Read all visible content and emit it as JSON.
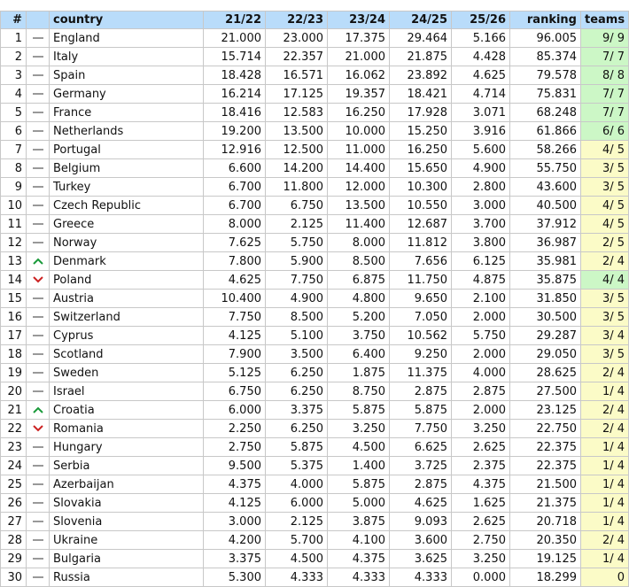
{
  "colors": {
    "header_bg": "#b9dcfa",
    "teams_full": "#ccf7c6",
    "teams_partial": "#fbfbc7",
    "trend_up": "#1a9a3a",
    "trend_down": "#cc2222",
    "trend_same": "#999999"
  },
  "headers": {
    "num": "#",
    "trend": "",
    "country": "country",
    "s1": "21/22",
    "s2": "22/23",
    "s3": "23/24",
    "s4": "24/25",
    "s5": "25/26",
    "ranking": "ranking",
    "teams": "teams"
  },
  "rows": [
    {
      "num": "1",
      "trend": "same",
      "country": "England",
      "s1": "21.000",
      "s2": "23.000",
      "s3": "17.375",
      "s4": "29.464",
      "s5": "5.166",
      "ranking": "96.005",
      "teams": "9/ 9",
      "full": true
    },
    {
      "num": "2",
      "trend": "same",
      "country": "Italy",
      "s1": "15.714",
      "s2": "22.357",
      "s3": "21.000",
      "s4": "21.875",
      "s5": "4.428",
      "ranking": "85.374",
      "teams": "7/ 7",
      "full": true
    },
    {
      "num": "3",
      "trend": "same",
      "country": "Spain",
      "s1": "18.428",
      "s2": "16.571",
      "s3": "16.062",
      "s4": "23.892",
      "s5": "4.625",
      "ranking": "79.578",
      "teams": "8/ 8",
      "full": true
    },
    {
      "num": "4",
      "trend": "same",
      "country": "Germany",
      "s1": "16.214",
      "s2": "17.125",
      "s3": "19.357",
      "s4": "18.421",
      "s5": "4.714",
      "ranking": "75.831",
      "teams": "7/ 7",
      "full": true
    },
    {
      "num": "5",
      "trend": "same",
      "country": "France",
      "s1": "18.416",
      "s2": "12.583",
      "s3": "16.250",
      "s4": "17.928",
      "s5": "3.071",
      "ranking": "68.248",
      "teams": "7/ 7",
      "full": true
    },
    {
      "num": "6",
      "trend": "same",
      "country": "Netherlands",
      "s1": "19.200",
      "s2": "13.500",
      "s3": "10.000",
      "s4": "15.250",
      "s5": "3.916",
      "ranking": "61.866",
      "teams": "6/ 6",
      "full": true
    },
    {
      "num": "7",
      "trend": "same",
      "country": "Portugal",
      "s1": "12.916",
      "s2": "12.500",
      "s3": "11.000",
      "s4": "16.250",
      "s5": "5.600",
      "ranking": "58.266",
      "teams": "4/ 5",
      "full": false
    },
    {
      "num": "8",
      "trend": "same",
      "country": "Belgium",
      "s1": "6.600",
      "s2": "14.200",
      "s3": "14.400",
      "s4": "15.650",
      "s5": "4.900",
      "ranking": "55.750",
      "teams": "3/ 5",
      "full": false
    },
    {
      "num": "9",
      "trend": "same",
      "country": "Turkey",
      "s1": "6.700",
      "s2": "11.800",
      "s3": "12.000",
      "s4": "10.300",
      "s5": "2.800",
      "ranking": "43.600",
      "teams": "3/ 5",
      "full": false
    },
    {
      "num": "10",
      "trend": "same",
      "country": "Czech Republic",
      "s1": "6.700",
      "s2": "6.750",
      "s3": "13.500",
      "s4": "10.550",
      "s5": "3.000",
      "ranking": "40.500",
      "teams": "4/ 5",
      "full": false
    },
    {
      "num": "11",
      "trend": "same",
      "country": "Greece",
      "s1": "8.000",
      "s2": "2.125",
      "s3": "11.400",
      "s4": "12.687",
      "s5": "3.700",
      "ranking": "37.912",
      "teams": "4/ 5",
      "full": false
    },
    {
      "num": "12",
      "trend": "same",
      "country": "Norway",
      "s1": "7.625",
      "s2": "5.750",
      "s3": "8.000",
      "s4": "11.812",
      "s5": "3.800",
      "ranking": "36.987",
      "teams": "2/ 5",
      "full": false
    },
    {
      "num": "13",
      "trend": "up",
      "country": "Denmark",
      "s1": "7.800",
      "s2": "5.900",
      "s3": "8.500",
      "s4": "7.656",
      "s5": "6.125",
      "ranking": "35.981",
      "teams": "2/ 4",
      "full": false
    },
    {
      "num": "14",
      "trend": "down",
      "country": "Poland",
      "s1": "4.625",
      "s2": "7.750",
      "s3": "6.875",
      "s4": "11.750",
      "s5": "4.875",
      "ranking": "35.875",
      "teams": "4/ 4",
      "full": true
    },
    {
      "num": "15",
      "trend": "same",
      "country": "Austria",
      "s1": "10.400",
      "s2": "4.900",
      "s3": "4.800",
      "s4": "9.650",
      "s5": "2.100",
      "ranking": "31.850",
      "teams": "3/ 5",
      "full": false
    },
    {
      "num": "16",
      "trend": "same",
      "country": "Switzerland",
      "s1": "7.750",
      "s2": "8.500",
      "s3": "5.200",
      "s4": "7.050",
      "s5": "2.000",
      "ranking": "30.500",
      "teams": "3/ 5",
      "full": false
    },
    {
      "num": "17",
      "trend": "same",
      "country": "Cyprus",
      "s1": "4.125",
      "s2": "5.100",
      "s3": "3.750",
      "s4": "10.562",
      "s5": "5.750",
      "ranking": "29.287",
      "teams": "3/ 4",
      "full": false
    },
    {
      "num": "18",
      "trend": "same",
      "country": "Scotland",
      "s1": "7.900",
      "s2": "3.500",
      "s3": "6.400",
      "s4": "9.250",
      "s5": "2.000",
      "ranking": "29.050",
      "teams": "3/ 5",
      "full": false
    },
    {
      "num": "19",
      "trend": "same",
      "country": "Sweden",
      "s1": "5.125",
      "s2": "6.250",
      "s3": "1.875",
      "s4": "11.375",
      "s5": "4.000",
      "ranking": "28.625",
      "teams": "2/ 4",
      "full": false
    },
    {
      "num": "20",
      "trend": "same",
      "country": "Israel",
      "s1": "6.750",
      "s2": "6.250",
      "s3": "8.750",
      "s4": "2.875",
      "s5": "2.875",
      "ranking": "27.500",
      "teams": "1/ 4",
      "full": false
    },
    {
      "num": "21",
      "trend": "up",
      "country": "Croatia",
      "s1": "6.000",
      "s2": "3.375",
      "s3": "5.875",
      "s4": "5.875",
      "s5": "2.000",
      "ranking": "23.125",
      "teams": "2/ 4",
      "full": false
    },
    {
      "num": "22",
      "trend": "down",
      "country": "Romania",
      "s1": "2.250",
      "s2": "6.250",
      "s3": "3.250",
      "s4": "7.750",
      "s5": "3.250",
      "ranking": "22.750",
      "teams": "2/ 4",
      "full": false
    },
    {
      "num": "23",
      "trend": "same",
      "country": "Hungary",
      "s1": "2.750",
      "s2": "5.875",
      "s3": "4.500",
      "s4": "6.625",
      "s5": "2.625",
      "ranking": "22.375",
      "teams": "1/ 4",
      "full": false
    },
    {
      "num": "24",
      "trend": "same",
      "country": "Serbia",
      "s1": "9.500",
      "s2": "5.375",
      "s3": "1.400",
      "s4": "3.725",
      "s5": "2.375",
      "ranking": "22.375",
      "teams": "1/ 4",
      "full": false
    },
    {
      "num": "25",
      "trend": "same",
      "country": "Azerbaijan",
      "s1": "4.375",
      "s2": "4.000",
      "s3": "5.875",
      "s4": "2.875",
      "s5": "4.375",
      "ranking": "21.500",
      "teams": "1/ 4",
      "full": false
    },
    {
      "num": "26",
      "trend": "same",
      "country": "Slovakia",
      "s1": "4.125",
      "s2": "6.000",
      "s3": "5.000",
      "s4": "4.625",
      "s5": "1.625",
      "ranking": "21.375",
      "teams": "1/ 4",
      "full": false
    },
    {
      "num": "27",
      "trend": "same",
      "country": "Slovenia",
      "s1": "3.000",
      "s2": "2.125",
      "s3": "3.875",
      "s4": "9.093",
      "s5": "2.625",
      "ranking": "20.718",
      "teams": "1/ 4",
      "full": false
    },
    {
      "num": "28",
      "trend": "same",
      "country": "Ukraine",
      "s1": "4.200",
      "s2": "5.700",
      "s3": "4.100",
      "s4": "3.600",
      "s5": "2.750",
      "ranking": "20.350",
      "teams": "2/ 4",
      "full": false
    },
    {
      "num": "29",
      "trend": "same",
      "country": "Bulgaria",
      "s1": "3.375",
      "s2": "4.500",
      "s3": "4.375",
      "s4": "3.625",
      "s5": "3.250",
      "ranking": "19.125",
      "teams": "1/ 4",
      "full": false
    },
    {
      "num": "30",
      "trend": "same",
      "country": "Russia",
      "s1": "5.300",
      "s2": "4.333",
      "s3": "4.333",
      "s4": "4.333",
      "s5": "0.000",
      "ranking": "18.299",
      "teams": "0",
      "full": false
    }
  ]
}
